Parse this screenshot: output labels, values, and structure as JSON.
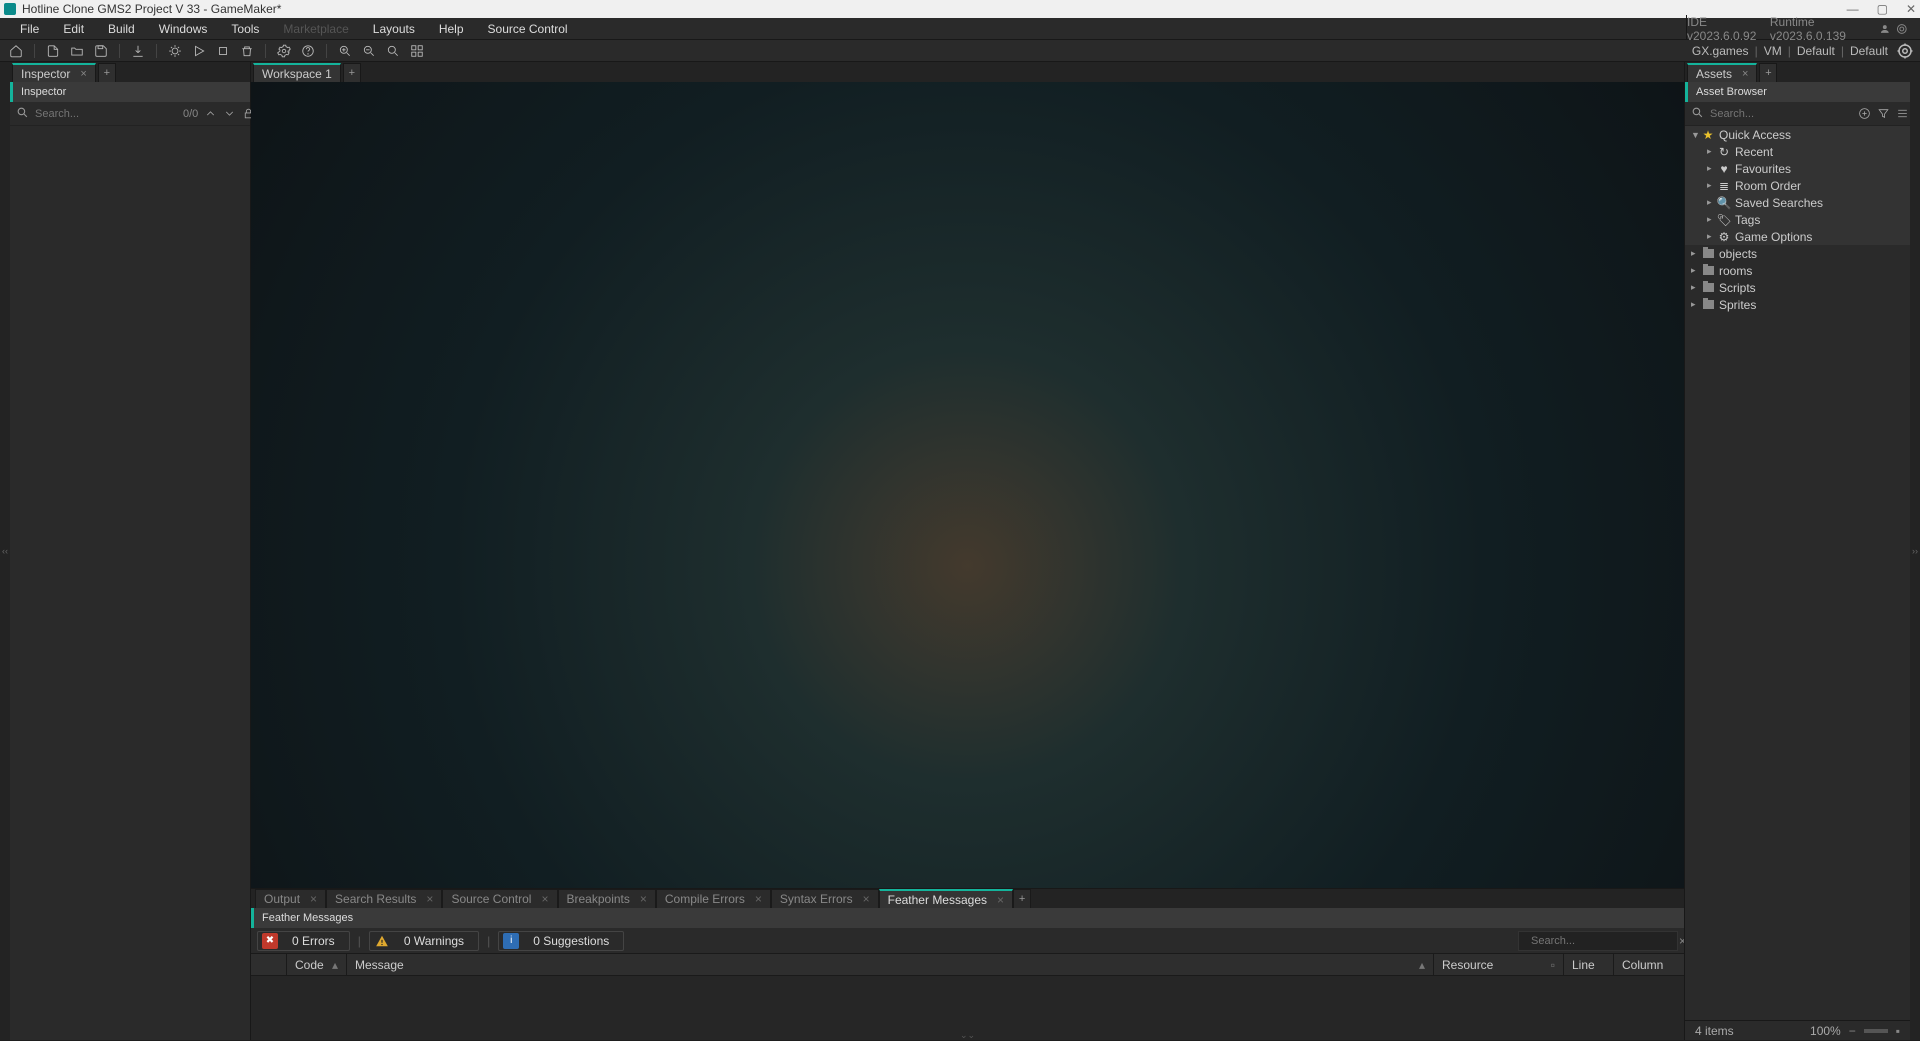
{
  "title": "Hotline Clone GMS2 Project V 33 - GameMaker*",
  "menu": [
    "File",
    "Edit",
    "Build",
    "Windows",
    "Tools",
    "Marketplace",
    "Layouts",
    "Help",
    "Source Control"
  ],
  "version_ide": "IDE v2023.6.0.92",
  "version_rt": "Runtime v2023.6.0.139",
  "targets": {
    "platform": "GX.games",
    "output": "VM",
    "device": "Default",
    "config": "Default"
  },
  "inspector": {
    "tab": "Inspector",
    "header": "Inspector",
    "search_ph": "Search...",
    "count": "0/0"
  },
  "workspace": {
    "tab": "Workspace 1"
  },
  "assets": {
    "tab": "Assets",
    "header": "Asset Browser",
    "search_ph": "Search...",
    "qa_label": "Quick Access",
    "qa": [
      "Recent",
      "Favourites",
      "Room Order",
      "Saved Searches",
      "Tags",
      "Game Options"
    ],
    "folders": [
      "objects",
      "rooms",
      "Scripts",
      "Sprites"
    ]
  },
  "bottom": {
    "tabs": [
      "Output",
      "Search Results",
      "Source Control",
      "Breakpoints",
      "Compile Errors",
      "Syntax Errors",
      "Feather Messages"
    ],
    "active": "Feather Messages",
    "header": "Feather Messages",
    "errors": "0 Errors",
    "warnings": "0 Warnings",
    "suggestions": "0 Suggestions",
    "search_ph": "Search...",
    "cols": {
      "code": "Code",
      "message": "Message",
      "resource": "Resource",
      "line": "Line",
      "column": "Column"
    }
  },
  "status": {
    "items": "4 items",
    "zoom": "100%"
  }
}
